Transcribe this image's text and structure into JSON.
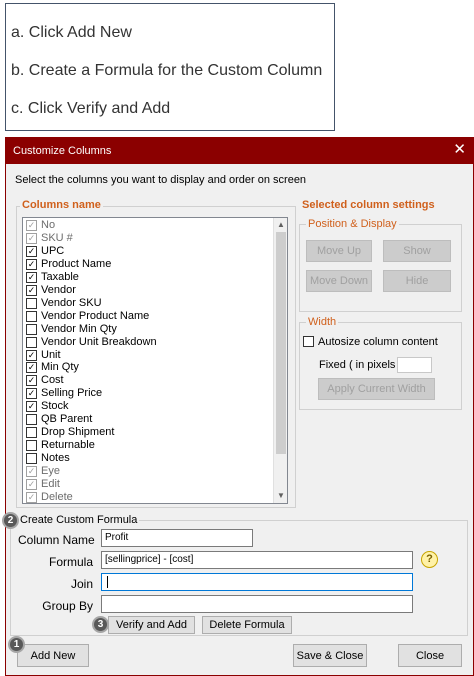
{
  "instructions": {
    "step_a": "a. Click Add New",
    "step_b": "b. Create a Formula for the Custom Column",
    "step_c": "c. Click Verify and Add"
  },
  "dialog": {
    "title": "Customize Columns",
    "close_glyph": "✕",
    "subtitle": "Select the columns you want to display and order on screen",
    "columns_heading": "Columns name",
    "columns": [
      {
        "label": "No",
        "checked": true,
        "disabled": true
      },
      {
        "label": "SKU #",
        "checked": true,
        "disabled": true
      },
      {
        "label": "UPC",
        "checked": true,
        "disabled": false
      },
      {
        "label": "Product Name",
        "checked": true,
        "disabled": false
      },
      {
        "label": "Taxable",
        "checked": true,
        "disabled": false
      },
      {
        "label": "Vendor",
        "checked": true,
        "disabled": false
      },
      {
        "label": "Vendor SKU",
        "checked": false,
        "disabled": false
      },
      {
        "label": "Vendor Product Name",
        "checked": false,
        "disabled": false
      },
      {
        "label": "Vendor Min Qty",
        "checked": false,
        "disabled": false
      },
      {
        "label": "Vendor Unit Breakdown",
        "checked": false,
        "disabled": false
      },
      {
        "label": "Unit",
        "checked": true,
        "disabled": false
      },
      {
        "label": "Min Qty",
        "checked": true,
        "disabled": false
      },
      {
        "label": "Cost",
        "checked": true,
        "disabled": false
      },
      {
        "label": "Selling Price",
        "checked": true,
        "disabled": false
      },
      {
        "label": "Stock",
        "checked": true,
        "disabled": false
      },
      {
        "label": "QB Parent",
        "checked": false,
        "disabled": false
      },
      {
        "label": "Drop Shipment",
        "checked": false,
        "disabled": false
      },
      {
        "label": "Returnable",
        "checked": false,
        "disabled": false
      },
      {
        "label": "Notes",
        "checked": false,
        "disabled": false
      },
      {
        "label": "Eye",
        "checked": true,
        "disabled": true
      },
      {
        "label": "Edit",
        "checked": true,
        "disabled": true
      },
      {
        "label": "Delete",
        "checked": true,
        "disabled": true
      }
    ],
    "selected_settings": {
      "heading": "Selected column settings",
      "position_group": "Position & Display",
      "move_up": "Move Up",
      "show": "Show",
      "move_down": "Move Down",
      "hide": "Hide",
      "width_group": "Width",
      "autosize_label": "Autosize column content",
      "fixed_label": "Fixed ( in pixels )",
      "fixed_value": "",
      "apply_width": "Apply Current Width"
    },
    "formula": {
      "group_label": "Create Custom Formula",
      "column_name_label": "Column Name",
      "column_name_value": "Profit",
      "formula_label": "Formula",
      "formula_value": "[sellingprice] - [cost]",
      "join_label": "Join",
      "join_value": "",
      "group_by_label": "Group By",
      "group_by_value": "",
      "verify_add": "Verify and Add",
      "delete_formula": "Delete Formula",
      "help_glyph": "?"
    },
    "footer": {
      "add_new": "Add New",
      "save_close": "Save & Close",
      "close": "Close"
    },
    "step_markers": [
      "1",
      "2",
      "3"
    ]
  },
  "colors": {
    "titlebar": "#8b0000",
    "section_heading": "#d0601c",
    "dialog_bg": "#f0f0f0"
  }
}
